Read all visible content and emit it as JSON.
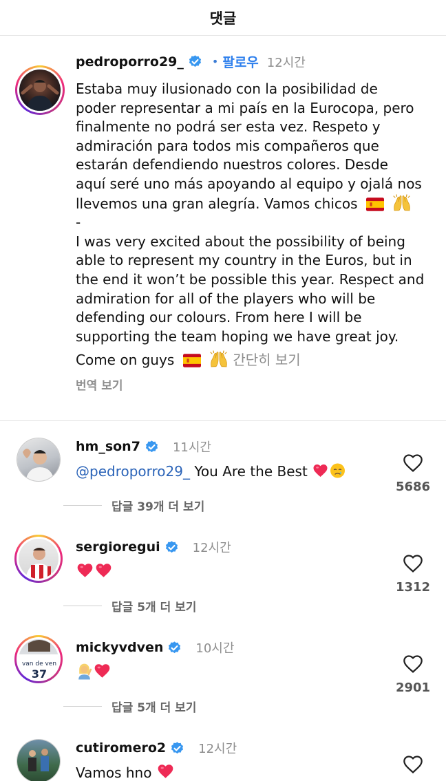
{
  "header": {
    "title": "댓글"
  },
  "post": {
    "username": "pedroporro29_",
    "dot": "•",
    "follow_label": "팔로우",
    "time": "12시간",
    "caption_lines": [
      "Estaba muy ilusionado con la posibilidad de",
      "poder representar a mi país en la Eurocopa, pero",
      "finalmente no podrá ser esta vez. Respeto y",
      "admiración para todos mis compañeros que",
      "estarán defendiendo nuestros colores. Desde",
      "aquí seré uno más apoyando al equipo y ojalá nos",
      "llevemos una gran alegría. Vamos chicos",
      "-",
      "I was very excited about the possibility of being",
      "able to represent my country in the Euros, but in",
      "the end it won’t be possible this year. Respect and",
      "admiration for all of the players who will be",
      "defending our colours. From here I will be",
      "supporting the team hoping we have great joy.",
      "Come on guys"
    ],
    "more_label": "간단히 보기",
    "translate_label": "번역 보기"
  },
  "comments": [
    {
      "username": "hm_son7",
      "time": "11시간",
      "mention": "@pedroporro29_",
      "text": " You Are the Best ",
      "likes": "5686",
      "replies_label": "답글 39개 더 보기",
      "avatar_icon": "heart-hands-photo"
    },
    {
      "username": "sergioregui",
      "time": "12시간",
      "mention": "",
      "text": "",
      "likes": "1312",
      "replies_label": "답글 5개 더 보기",
      "avatar_icon": "red-white-jersey-photo"
    },
    {
      "username": "mickyvdven",
      "time": "10시간",
      "mention": "",
      "text": "",
      "likes": "2901",
      "replies_label": "답글 5개 더 보기",
      "avatar_icon": "van-de-ven-jersey-photo"
    },
    {
      "username": "cutiromero2",
      "time": "12시간",
      "mention": "",
      "text": "Vamos hno ",
      "likes": "",
      "replies_label": "",
      "avatar_icon": "stadium-photo"
    }
  ],
  "colors": {
    "verified": "#3897f0",
    "follow": "#2f80ed",
    "heart": "#ee2a55",
    "mention": "#2a63b8"
  }
}
